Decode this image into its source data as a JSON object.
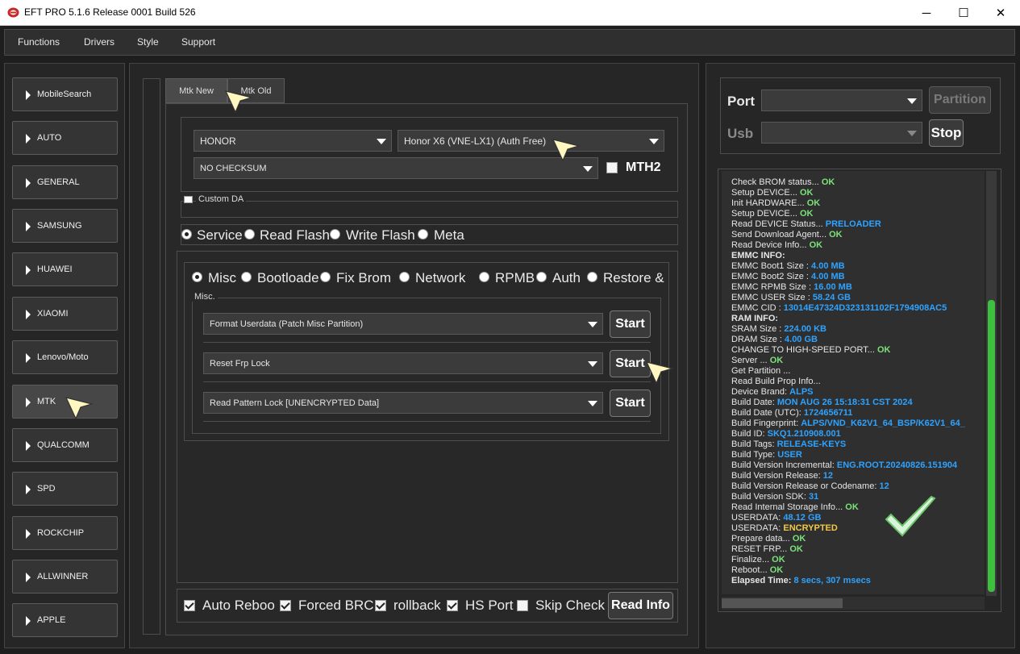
{
  "window": {
    "title": "EFT PRO 5.1.6 Release 0001 Build 526",
    "minimize_glyph": "─",
    "maximize_glyph": "☐",
    "close_glyph": "✕"
  },
  "menu": [
    "Functions",
    "Drivers",
    "Style",
    "Support"
  ],
  "sidebar": {
    "items": [
      "MobileSearch",
      "AUTO",
      "GENERAL",
      "SAMSUNG",
      "HUAWEI",
      "XIAOMI",
      "Lenovo/Moto",
      "MTK",
      "QUALCOMM",
      "SPD",
      "ROCKCHIP",
      "ALLWINNER",
      "APPLE"
    ],
    "active": "MTK"
  },
  "tabs": [
    "Mtk New",
    "Mtk Old"
  ],
  "device": {
    "brand": "HONOR",
    "model": "Honor X6 (VNE-LX1) (Auth Free)",
    "checksum": "NO CHECKSUM",
    "mth2_label": "MTH2",
    "custom_da_label": "Custom DA"
  },
  "modes": [
    "Service",
    "Read Flash",
    "Write Flash",
    "Meta"
  ],
  "subtabs": [
    "Misc",
    "Bootloade",
    "Fix Brom",
    "Network",
    "RPMB",
    "Auth",
    "Restore &"
  ],
  "misc": {
    "group_label": "Misc.",
    "operations": [
      "Format Userdata (Patch Misc Partition)",
      "Reset Frp Lock",
      "Read Pattern Lock [UNENCRYPTED Data]"
    ],
    "start_label": "Start"
  },
  "bottom_options": [
    {
      "label": "Auto Reboo",
      "checked": true
    },
    {
      "label": "Forced BRC",
      "checked": true
    },
    {
      "label": "rollback",
      "checked": true
    },
    {
      "label": "HS Port",
      "checked": true
    },
    {
      "label": "Skip Check I",
      "checked": false
    }
  ],
  "read_info_label": "Read Info",
  "port": {
    "port_label": "Port",
    "usb_label": "Usb",
    "partition_label": "Partition",
    "stop_label": "Stop"
  },
  "log": [
    {
      "text": "Check BROM status... ",
      "value": "OK",
      "cls": "ok"
    },
    {
      "text": "Setup DEVICE... ",
      "value": "OK",
      "cls": "ok"
    },
    {
      "text": "Init HARDWARE... ",
      "value": "OK",
      "cls": "ok"
    },
    {
      "text": "Setup DEVICE... ",
      "value": "OK",
      "cls": "ok"
    },
    {
      "text": "Read DEVICE Status... ",
      "value": "PRELOADER",
      "cls": "blue"
    },
    {
      "text": "Send Download Agent... ",
      "value": "OK",
      "cls": "ok"
    },
    {
      "text": "Read Device Info... ",
      "value": "OK",
      "cls": "ok"
    },
    {
      "text": " EMMC INFO:",
      "value": "",
      "cls": "bold"
    },
    {
      "text": "EMMC Boot1 Size : ",
      "value": "4.00 MB",
      "cls": "blue"
    },
    {
      "text": "EMMC Boot2 Size : ",
      "value": "4.00 MB",
      "cls": "blue"
    },
    {
      "text": "EMMC RPMB Size : ",
      "value": "16.00 MB",
      "cls": "blue"
    },
    {
      "text": "EMMC USER Size : ",
      "value": "58.24 GB",
      "cls": "blue"
    },
    {
      "text": "EMMC CID : ",
      "value": "13014E47324D323131102F1794908AC5",
      "cls": "blue"
    },
    {
      "text": " RAM INFO:",
      "value": "",
      "cls": "bold"
    },
    {
      "text": "SRAM Size : ",
      "value": "224.00 KB",
      "cls": "blue"
    },
    {
      "text": "DRAM Size : ",
      "value": "4.00 GB",
      "cls": "blue"
    },
    {
      "text": "CHANGE TO HIGH-SPEED PORT... ",
      "value": "OK",
      "cls": "ok"
    },
    {
      "text": "Server ... ",
      "value": "OK",
      "cls": "ok"
    },
    {
      "text": "Get Partition ...",
      "value": "",
      "cls": ""
    },
    {
      "text": "Read Build Prop Info...",
      "value": "",
      "cls": ""
    },
    {
      "text": " Device Brand: ",
      "value": "ALPS",
      "cls": "blue"
    },
    {
      "text": " Build Date: ",
      "value": "MON AUG 26 15:18:31 CST 2024",
      "cls": "blue"
    },
    {
      "text": " Build Date (UTC): ",
      "value": "1724656711",
      "cls": "blue"
    },
    {
      "text": " Build Fingerprint: ",
      "value": "ALPS/VND_K62V1_64_BSP/K62V1_64_",
      "cls": "blue"
    },
    {
      "text": " Build ID: ",
      "value": "SKQ1.210908.001",
      "cls": "blue"
    },
    {
      "text": " Build Tags: ",
      "value": "RELEASE-KEYS",
      "cls": "blue"
    },
    {
      "text": " Build Type: ",
      "value": "USER",
      "cls": "blue"
    },
    {
      "text": " Build Version Incremental: ",
      "value": "ENG.ROOT.20240826.151904",
      "cls": "blue"
    },
    {
      "text": " Build Version Release: ",
      "value": "12",
      "cls": "blue"
    },
    {
      "text": " Build Version Release or Codename: ",
      "value": "12",
      "cls": "blue"
    },
    {
      "text": " Build Version SDK: ",
      "value": "31",
      "cls": "blue"
    },
    {
      "text": "Read Internal Storage Info... ",
      "value": "OK",
      "cls": "ok"
    },
    {
      "text": "USERDATA: ",
      "value": "48.12 GB",
      "cls": "blue"
    },
    {
      "text": "USERDATA: ",
      "value": "ENCRYPTED",
      "cls": "yel"
    },
    {
      "text": "Prepare data... ",
      "value": "OK",
      "cls": "ok"
    },
    {
      "text": "RESET FRP... ",
      "value": "OK",
      "cls": "ok"
    },
    {
      "text": "Finalize... ",
      "value": "OK",
      "cls": "ok"
    },
    {
      "text": "Reboot... ",
      "value": "OK",
      "cls": "ok"
    },
    {
      "text": " Elapsed Time: ",
      "value": "8 secs, 307 msecs",
      "cls": "blue"
    }
  ]
}
